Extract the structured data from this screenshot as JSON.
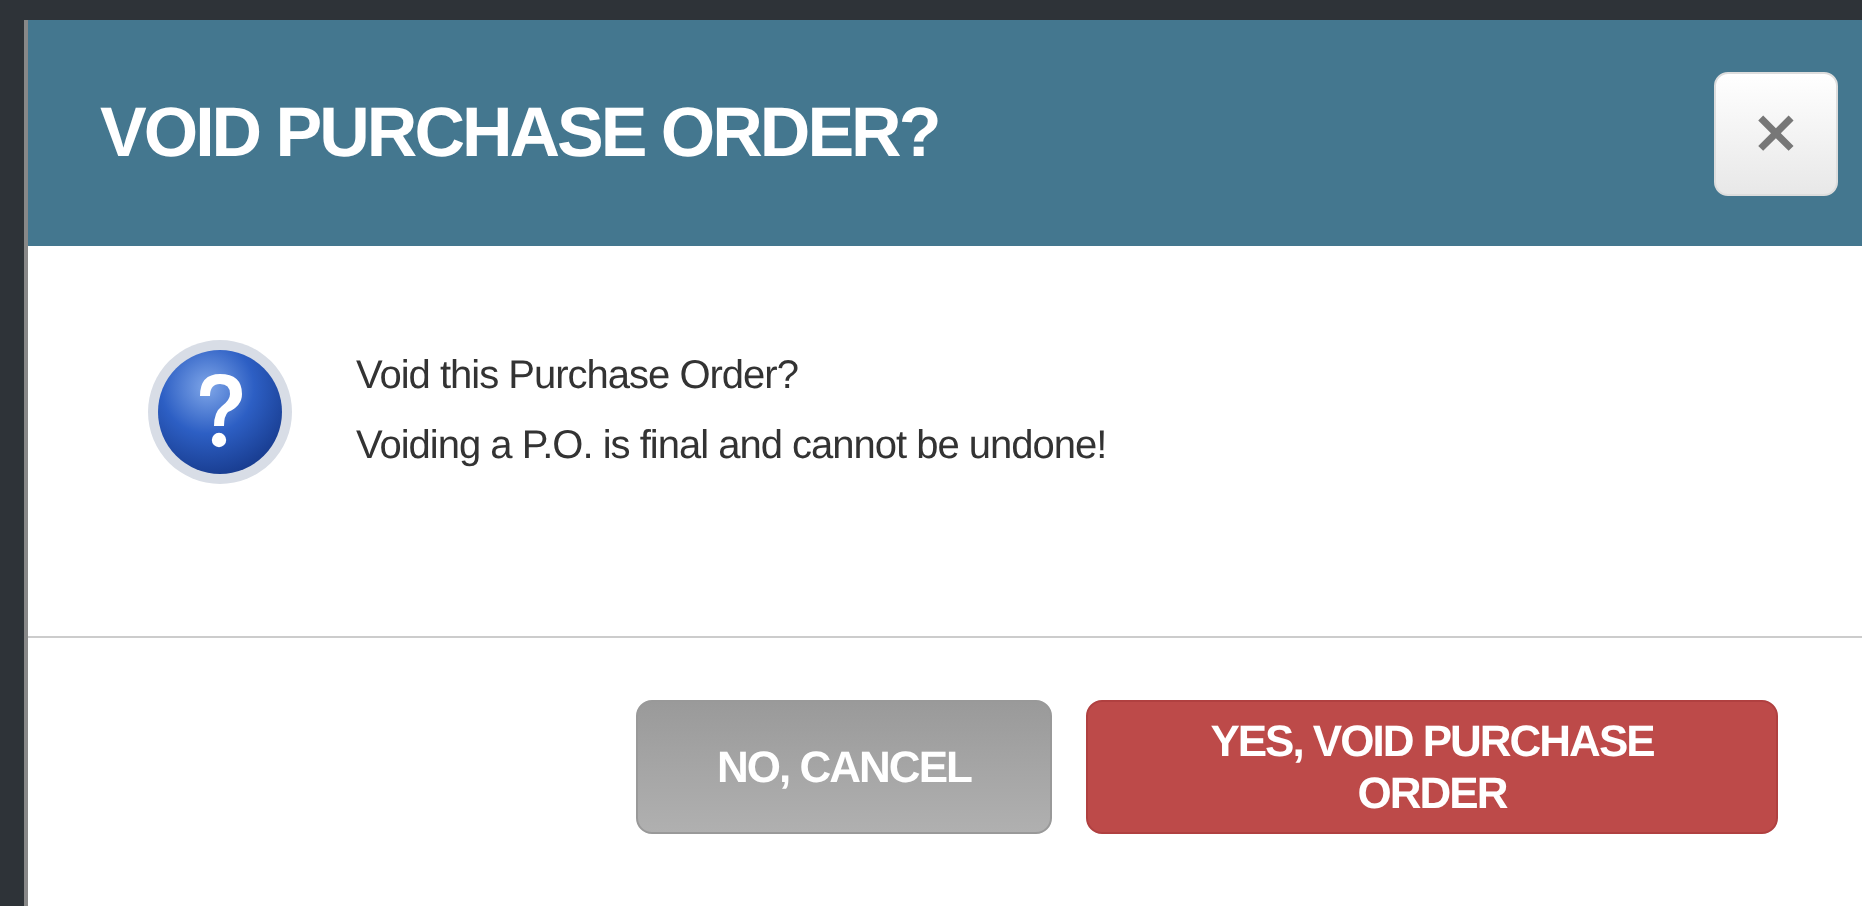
{
  "dialog": {
    "title": "VOID PURCHASE ORDER?",
    "close_label": "×",
    "message": [
      "Void this Purchase Order?",
      "Voiding a P.O. is final and cannot be undone!"
    ],
    "buttons": [
      {
        "label": "NO, CANCEL",
        "kind": "cancel"
      },
      {
        "label": "YES, VOID PURCHASE ORDER",
        "kind": "danger"
      }
    ]
  }
}
